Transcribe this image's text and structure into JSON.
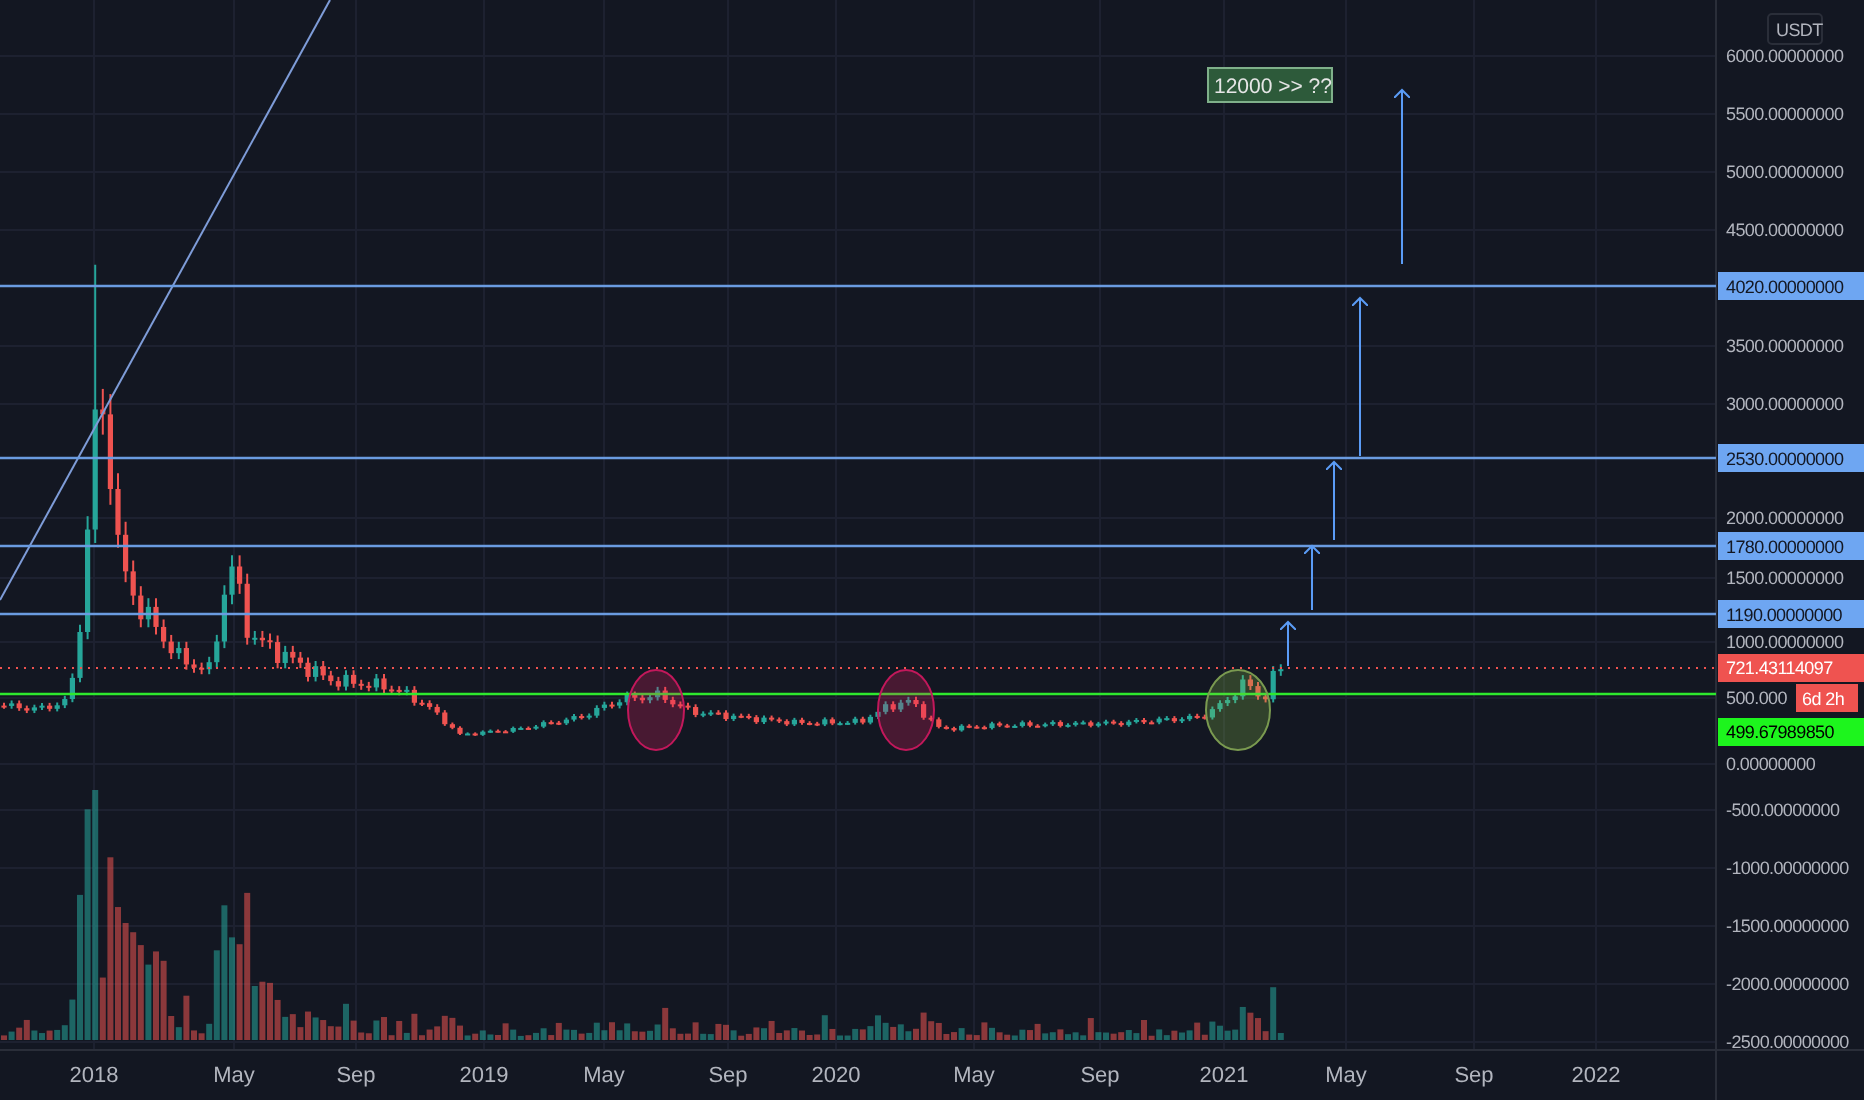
{
  "price_axis": {
    "unit": "USDT",
    "ticks": [
      "6000.00000000",
      "5500.00000000",
      "5000.00000000",
      "4500.00000000",
      "3500.00000000",
      "3000.00000000",
      "2000.00000000",
      "1500.00000000",
      "1000.00000000",
      "500.000",
      "0.00000000",
      "-500.00000000",
      "-1000.00000000",
      "-1500.00000000",
      "-2000.00000000",
      "-2500.00000000"
    ]
  },
  "levels": [
    {
      "label": "4020.00000000"
    },
    {
      "label": "2530.00000000"
    },
    {
      "label": "1780.00000000"
    },
    {
      "label": "1190.00000000"
    }
  ],
  "last_price": {
    "label": "721.43114097",
    "countdown": "6d 2h"
  },
  "support": {
    "label": "499.67989850"
  },
  "annotation": {
    "text": "12000 >> ??"
  },
  "time_axis": {
    "ticks": [
      "2018",
      "May",
      "Sep",
      "2019",
      "May",
      "Sep",
      "2020",
      "May",
      "Sep",
      "2021",
      "May",
      "Sep",
      "2022"
    ]
  }
}
